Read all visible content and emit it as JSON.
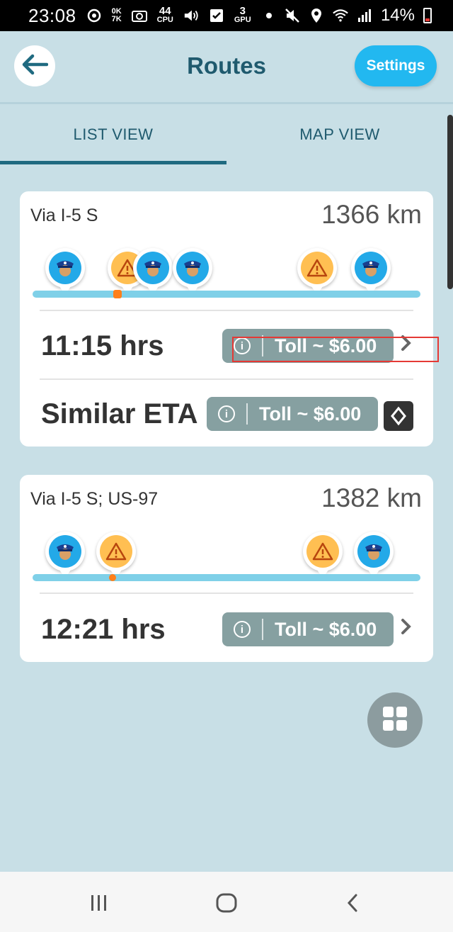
{
  "status_bar": {
    "time": "23:08",
    "net_top": "0K",
    "net_bottom": "7K",
    "cpu_value": "44",
    "cpu_label": "CPU",
    "gpu_value": "3",
    "gpu_label": "GPU",
    "battery": "14%"
  },
  "header": {
    "title": "Routes",
    "settings_label": "Settings"
  },
  "tabs": [
    {
      "label": "LIST VIEW",
      "selected": true
    },
    {
      "label": "MAP VIEW",
      "selected": false
    }
  ],
  "routes": [
    {
      "via": "Via I-5 S",
      "distance": "1366 km",
      "eta": "11:15 hrs",
      "toll": "Toll ~ $6.00",
      "alternate_eta": "Similar ETA",
      "alternate_toll": "Toll ~ $6.00"
    },
    {
      "via": "Via I-5 S; US-97",
      "distance": "1382 km",
      "eta": "12:21 hrs",
      "toll": "Toll ~ $6.00"
    }
  ],
  "icons": {
    "back": "arrow-left-icon",
    "police": "police-icon",
    "hazard": "hazard-icon",
    "info": "info-icon",
    "chevron": "chevron-right-icon",
    "grid": "grid-icon",
    "diamond": "diamond-icon"
  },
  "colors": {
    "background": "#c8dfe6",
    "accent": "#22b8f0",
    "title": "#1f5a6e",
    "toll_pill": "#86a0a1",
    "route_line": "#7fd0e8",
    "progress": "#ff7f1a"
  },
  "info_glyph": "i"
}
